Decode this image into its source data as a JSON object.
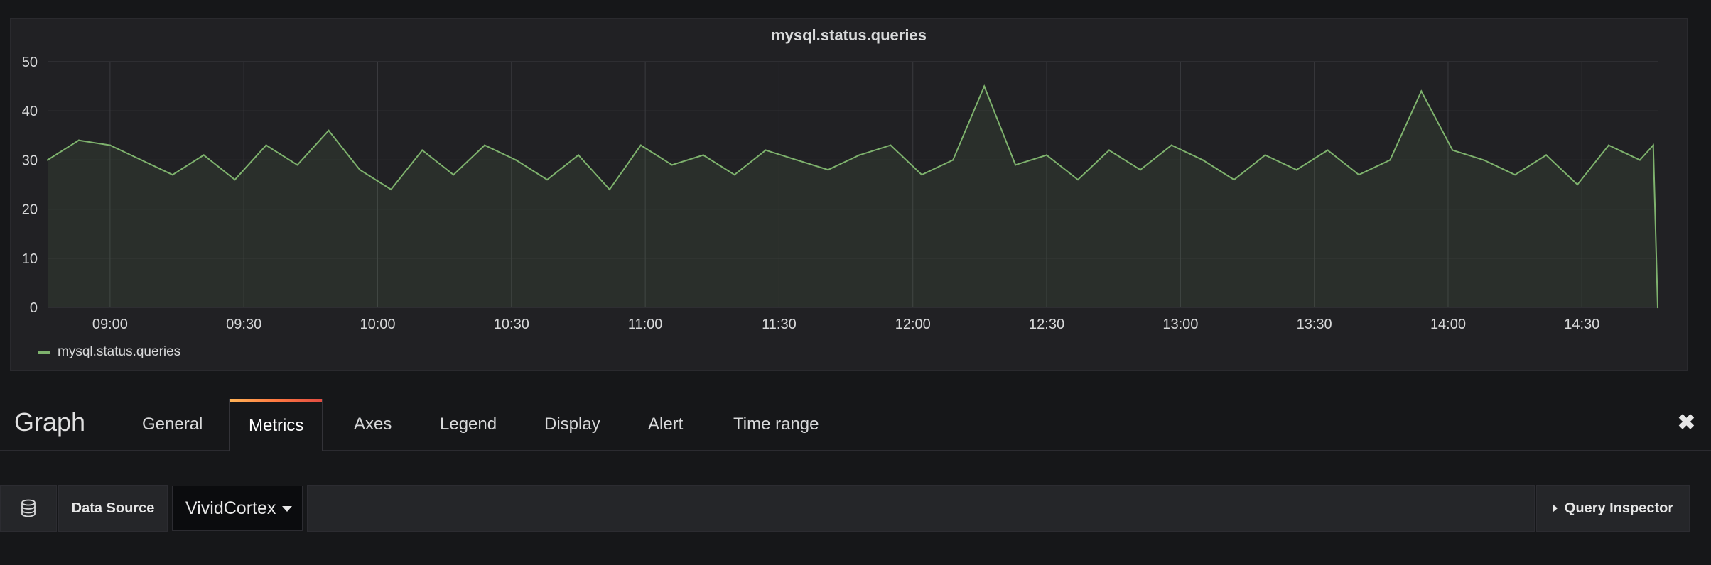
{
  "panel": {
    "title": "mysql.status.queries"
  },
  "chart_data": {
    "type": "area",
    "title": "mysql.status.queries",
    "xlabel": "",
    "ylabel": "",
    "ylim": [
      0,
      50
    ],
    "y_ticks": [
      "0",
      "10",
      "20",
      "30",
      "40",
      "50"
    ],
    "x_ticks": [
      "09:00",
      "09:30",
      "10:00",
      "10:30",
      "11:00",
      "11:30",
      "12:00",
      "12:30",
      "13:00",
      "13:30",
      "14:00",
      "14:30"
    ],
    "x_range": [
      "08:46",
      "14:47"
    ],
    "grid": true,
    "legend_position": "bottom-left",
    "series": [
      {
        "name": "mysql.status.queries",
        "color": "#7eb26d",
        "x": [
          "08:46",
          "08:53",
          "09:00",
          "09:07",
          "09:14",
          "09:21",
          "09:28",
          "09:35",
          "09:42",
          "09:49",
          "09:56",
          "10:03",
          "10:10",
          "10:17",
          "10:24",
          "10:31",
          "10:38",
          "10:45",
          "10:52",
          "10:59",
          "11:06",
          "11:13",
          "11:20",
          "11:27",
          "11:34",
          "11:41",
          "11:48",
          "11:55",
          "12:02",
          "12:09",
          "12:16",
          "12:23",
          "12:30",
          "12:37",
          "12:44",
          "12:51",
          "12:58",
          "13:05",
          "13:12",
          "13:19",
          "13:26",
          "13:33",
          "13:40",
          "13:47",
          "13:54",
          "14:01",
          "14:08",
          "14:15",
          "14:22",
          "14:29",
          "14:36",
          "14:43",
          "14:46",
          "14:47"
        ],
        "values": [
          30,
          34,
          33,
          30,
          27,
          31,
          26,
          33,
          29,
          36,
          28,
          24,
          32,
          27,
          33,
          30,
          26,
          31,
          24,
          33,
          29,
          31,
          27,
          32,
          30,
          28,
          31,
          33,
          27,
          30,
          45,
          29,
          31,
          26,
          32,
          28,
          33,
          30,
          26,
          31,
          28,
          32,
          27,
          30,
          44,
          32,
          30,
          27,
          31,
          25,
          33,
          30,
          33,
          0
        ]
      }
    ]
  },
  "editor": {
    "title": "Graph",
    "tabs": [
      "General",
      "Metrics",
      "Axes",
      "Legend",
      "Display",
      "Alert",
      "Time range"
    ],
    "active_tab": "Metrics",
    "close_icon": "close-icon"
  },
  "datasource": {
    "label": "Data Source",
    "icon": "database-icon",
    "selected": "VividCortex",
    "query_inspector": "Query Inspector"
  },
  "colors": {
    "background": "#161719",
    "panel": "#212124",
    "series": "#7eb26d",
    "accent": "#ff7941"
  }
}
